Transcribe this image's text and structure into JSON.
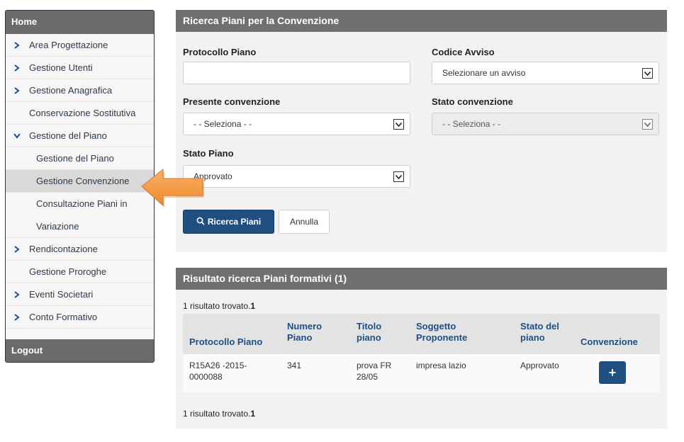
{
  "sidebar": {
    "home": "Home",
    "logout": "Logout",
    "items": [
      {
        "label": "Area Progettazione"
      },
      {
        "label": "Gestione Utenti"
      },
      {
        "label": "Gestione Anagrafica"
      },
      {
        "label": "Conservazione Sostitutiva"
      },
      {
        "label": "Gestione del Piano"
      },
      {
        "label": "Gestione del Piano"
      },
      {
        "label": "Gestione Convenzione"
      },
      {
        "label": "Consultazione Piani in Variazione"
      },
      {
        "label": "Rendicontazione"
      },
      {
        "label": "Gestione Proroghe"
      },
      {
        "label": "Eventi Societari"
      },
      {
        "label": "Conto Formativo"
      }
    ]
  },
  "search": {
    "title": "Ricerca Piani per la Convenzione",
    "protocollo_label": "Protocollo Piano",
    "protocollo_value": "",
    "codice_label": "Codice Avviso",
    "codice_value": "Selezionare un avviso",
    "presente_label": "Presente convenzione",
    "presente_value": "- - Seleziona - -",
    "stato_conv_label": "Stato convenzione",
    "stato_conv_value": "- - Seleziona - -",
    "stato_piano_label": "Stato Piano",
    "stato_piano_value": "Approvato",
    "search_button": "Ricerca Piani",
    "cancel_button": "Annulla"
  },
  "results": {
    "title": "Risultato ricerca Piani formativi (1)",
    "count_text": "1 risultato trovato.",
    "count_num": "1",
    "columns": [
      "Protocollo Piano",
      "Numero Piano",
      "Titolo piano",
      "Soggetto Proponente",
      "Stato del piano",
      "Convenzione"
    ],
    "rows": [
      {
        "protocollo": "R15A26 -2015-0000088",
        "numero": "341",
        "titolo": "prova FR 28/05",
        "soggetto": "impresa lazio",
        "stato": "Approvato",
        "action": "+"
      }
    ]
  },
  "colors": {
    "primary": "#1f4f80",
    "header_gray": "#707070",
    "arrow": "#f39a3c"
  }
}
